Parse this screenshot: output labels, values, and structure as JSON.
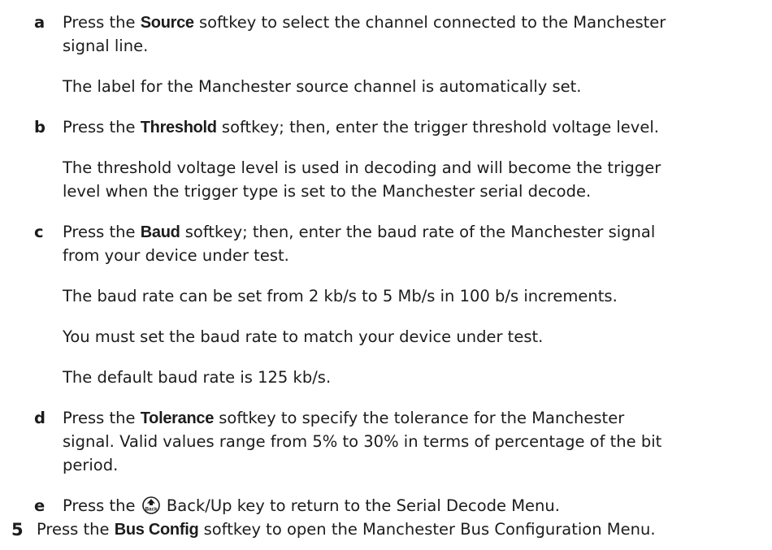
{
  "substeps": {
    "a": {
      "marker": "a",
      "pre": "Press the ",
      "keyword": "Source",
      "post_line1": " softkey to select the channel connected to the Manchester",
      "line2": "signal line.",
      "note": "The label for the Manchester source channel is automatically set."
    },
    "b": {
      "marker": "b",
      "pre": "Press the ",
      "keyword": "Threshold",
      "post": " softkey; then, enter the trigger threshold voltage level.",
      "note_line1": "The threshold voltage level is used in decoding and will become the trigger",
      "note_line2": "level when the trigger type is set to the Manchester serial decode."
    },
    "c": {
      "marker": "c",
      "pre": "Press the ",
      "keyword": "Baud",
      "post_line1": " softkey; then, enter the baud rate of the Manchester signal",
      "line2": "from your device under test.",
      "note1": "The baud rate can be set from 2 kb/s to 5 Mb/s in 100 b/s increments.",
      "note2": "You must set the baud rate to match your device under test.",
      "note3": "The default baud rate is 125 kb/s."
    },
    "d": {
      "marker": "d",
      "pre": "Press the ",
      "keyword": "Tolerance",
      "post_line1": " softkey to specify the tolerance for the Manchester",
      "line2": "signal. Valid values range from 5% to 30% in terms of percentage of the bit",
      "line3": "period."
    },
    "e": {
      "marker": "e",
      "pre": "Press the ",
      "icon_label": "Back",
      "post": " Back/Up key to return to the Serial Decode Menu."
    }
  },
  "step5": {
    "number": "5",
    "pre": "Press the ",
    "keyword": "Bus Config",
    "post": " softkey to open the Manchester Bus Configuration Menu."
  }
}
